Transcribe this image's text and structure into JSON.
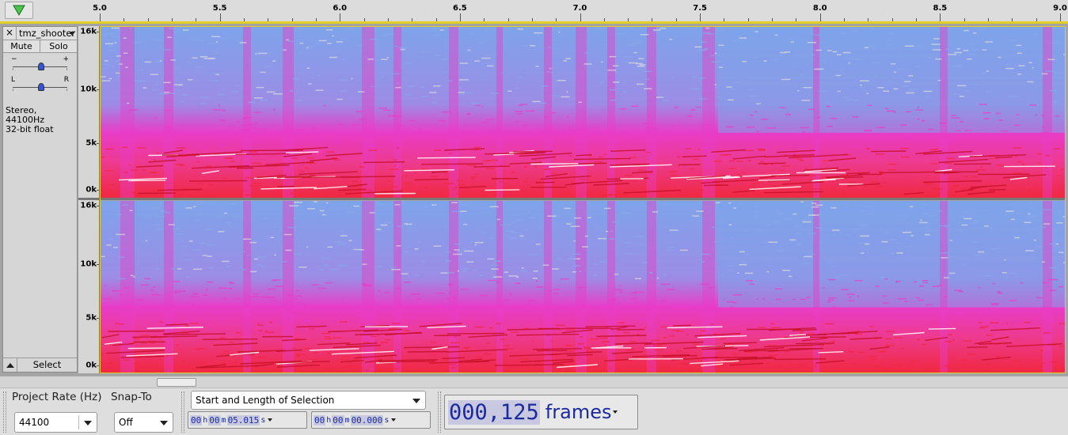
{
  "ruler": {
    "ticks": [
      {
        "label": "5.0"
      },
      {
        "label": "5.5"
      },
      {
        "label": "6.0"
      },
      {
        "label": "6.5"
      },
      {
        "label": "7.0"
      },
      {
        "label": "7.5"
      },
      {
        "label": "8.0"
      },
      {
        "label": "8.5"
      },
      {
        "label": "9.0"
      }
    ]
  },
  "track": {
    "close_glyph": "×",
    "name": "tmz_shooter",
    "mute_label": "Mute",
    "solo_label": "Solo",
    "gain_labels": {
      "minus": "−",
      "plus": "+"
    },
    "pan_labels": {
      "left": "L",
      "right": "R"
    },
    "format_line1": "Stereo, 44100Hz",
    "format_line2": "32-bit float",
    "select_label": "Select"
  },
  "channels": [
    {
      "name": "left",
      "freq_labels": [
        "16k",
        "10k",
        "5k",
        "0k"
      ]
    },
    {
      "name": "right",
      "freq_labels": [
        "16k",
        "10k",
        "5k",
        "0k"
      ]
    }
  ],
  "toolbar": {
    "project_rate_label": "Project Rate (Hz)",
    "project_rate_value": "44100",
    "snap_to_label": "Snap-To",
    "snap_to_value": "Off",
    "selection_mode": "Start and Length of Selection",
    "selection_start": {
      "h": "00",
      "m": "00",
      "s": "05.015"
    },
    "selection_length": {
      "h": "00",
      "m": "00",
      "s": "00.000"
    },
    "time_units": {
      "h": "h",
      "m": "m",
      "s": "s"
    },
    "audio_position": {
      "digits": "000,125",
      "unit": "frames"
    }
  },
  "colors": {
    "ruler_highlight": "#e3cf23",
    "spectrogram_low": "#f02840",
    "spectrogram_mid": "#e83cc8",
    "spectrogram_high": "#7ea4ea",
    "time_digit": "#1a2aa0"
  }
}
